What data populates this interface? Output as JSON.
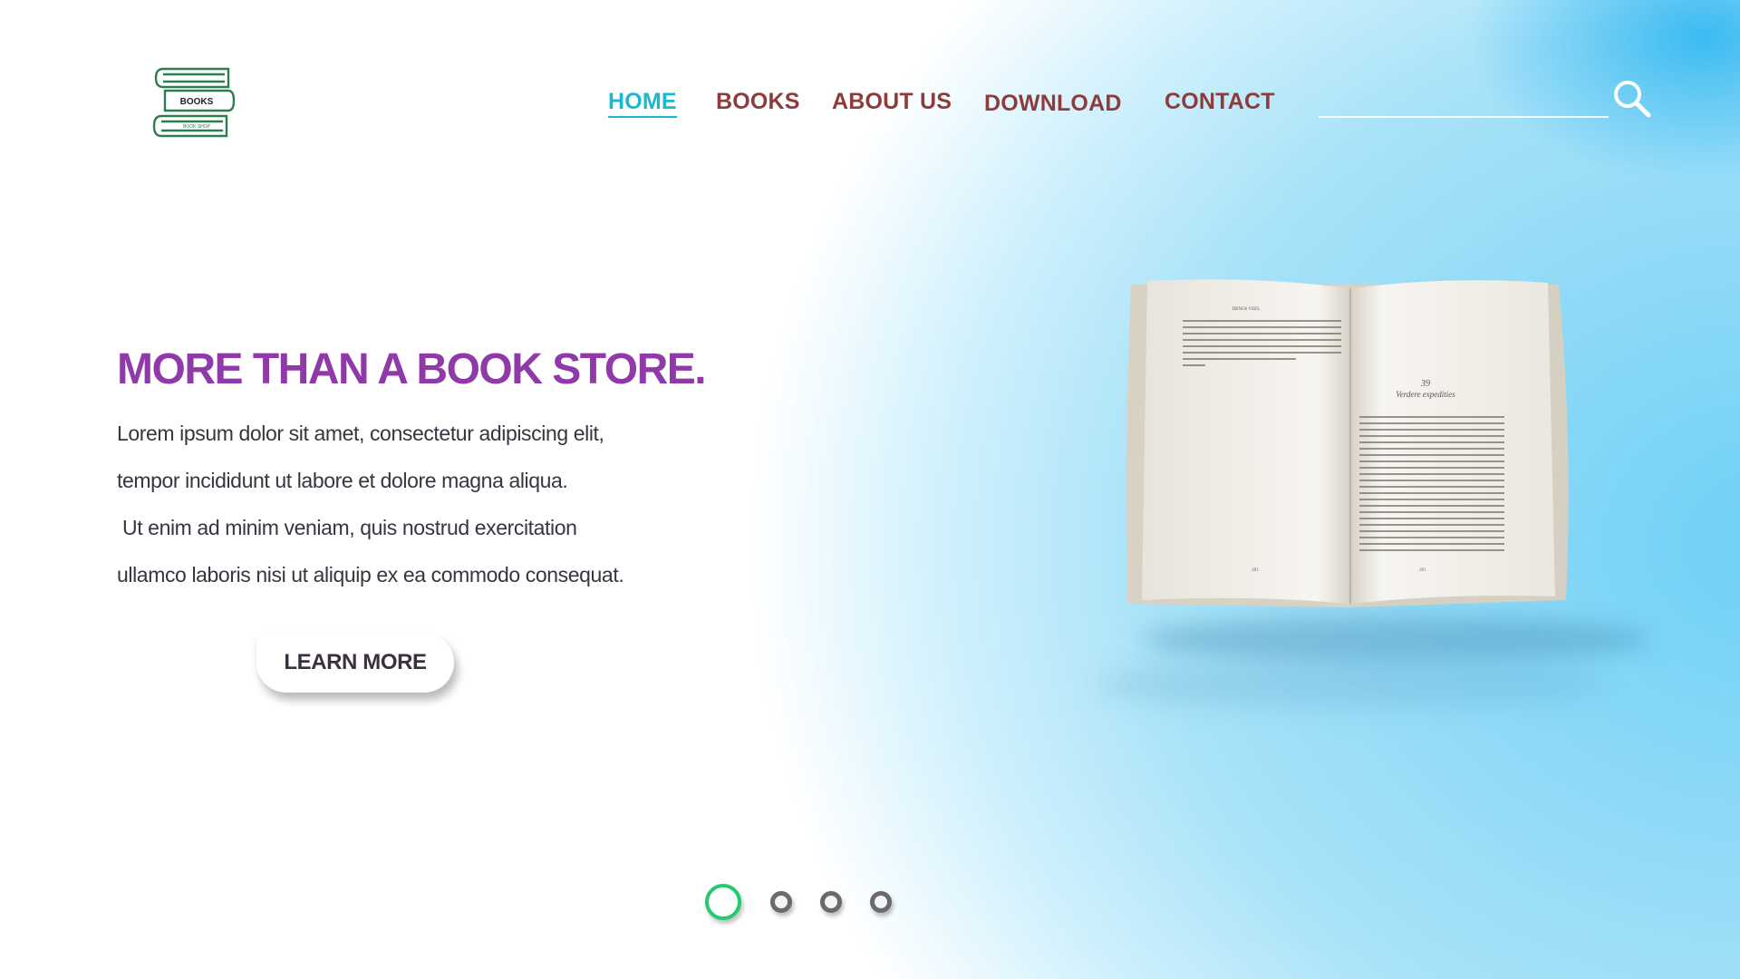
{
  "logo": {
    "title": "BOOKS",
    "subtitle": "BOOK SHOP"
  },
  "nav": [
    {
      "label": "HOME",
      "active": true
    },
    {
      "label": "BOOKS",
      "active": false
    },
    {
      "label": "ABOUT US",
      "active": false
    },
    {
      "label": "DOWNLOAD",
      "active": false
    },
    {
      "label": "CONTACT",
      "active": false
    }
  ],
  "search": {
    "value": "",
    "icon": "search-icon"
  },
  "hero": {
    "headline": "MORE THAN A BOOK STORE.",
    "body_lines": [
      "Lorem ipsum dolor sit amet, consectetur adipiscing elit,",
      "tempor incididunt ut labore et dolore magna aliqua.",
      " Ut enim ad minim veniam, quis nostrud exercitation",
      "ullamco laboris nisi ut aliquip ex ea commodo consequat."
    ],
    "button_label": "LEARN MORE"
  },
  "book": {
    "page_header": "DENOS VEEL",
    "chapter_number": "39",
    "chapter_title": "Verdere expedities",
    "page_left": "491",
    "page_right": "491"
  },
  "slider": {
    "count": 4,
    "active_index": 0
  },
  "colors": {
    "accent": "#1bb8d2",
    "nav": "#8e3b3b",
    "headline": "#8f3aa8",
    "active_dot": "#22cc6e",
    "logo": "#2e7d4f"
  }
}
